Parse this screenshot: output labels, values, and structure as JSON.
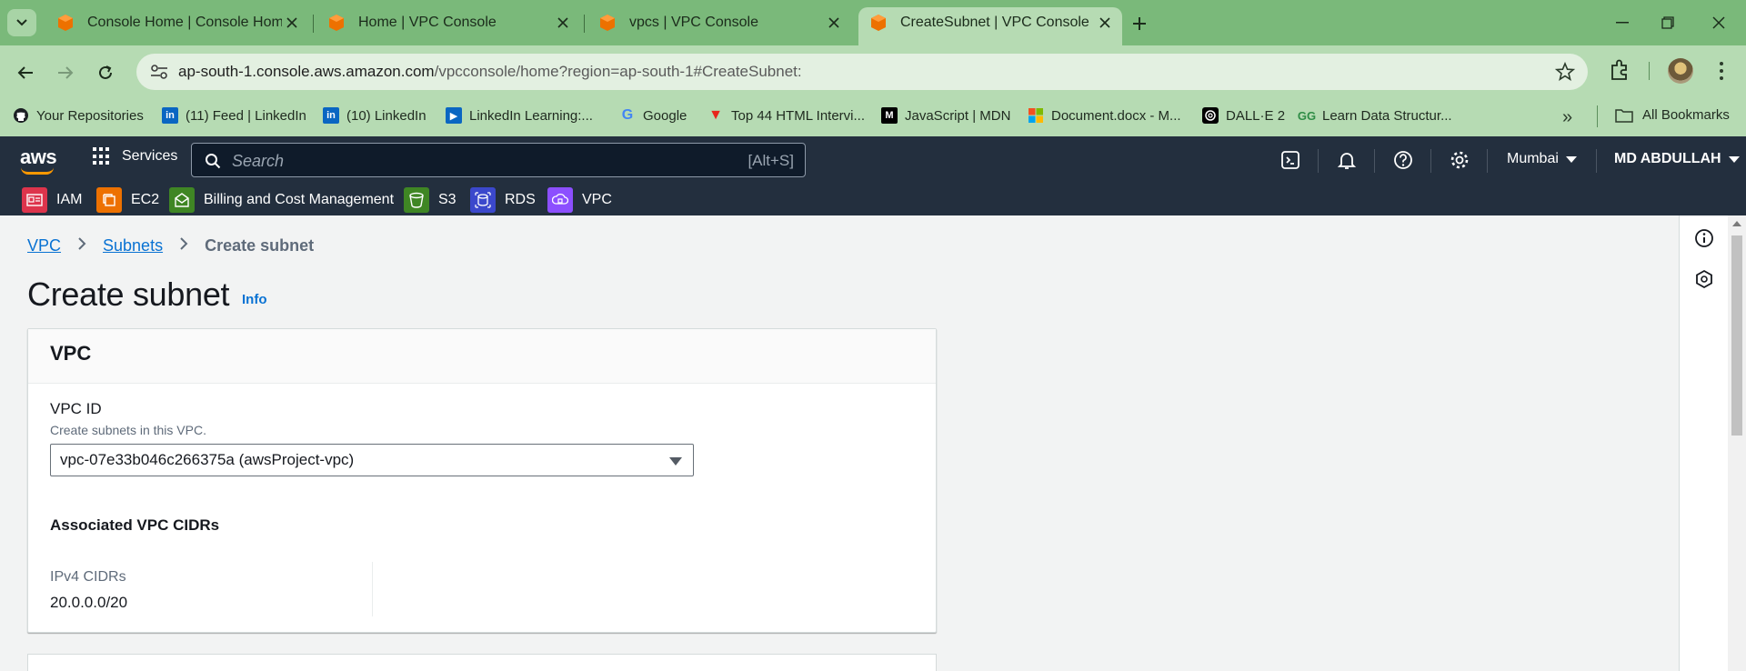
{
  "browser": {
    "tabs": [
      {
        "title": "Console Home | Console Home",
        "active": false
      },
      {
        "title": "Home | VPC Console",
        "active": false
      },
      {
        "title": "vpcs | VPC Console",
        "active": false
      },
      {
        "title": "CreateSubnet | VPC Console",
        "active": true
      }
    ],
    "url_host": "ap-south-1.console.aws.amazon.com",
    "url_path": "/vpcconsole/home?region=ap-south-1#CreateSubnet:",
    "bookmarks": [
      {
        "label": "Your Repositories",
        "icon": "github-icon"
      },
      {
        "label": "(11) Feed | LinkedIn",
        "icon": "linkedin-icon"
      },
      {
        "label": "(10) LinkedIn",
        "icon": "linkedin-icon"
      },
      {
        "label": "LinkedIn Learning:...",
        "icon": "linkedin-learning-icon"
      },
      {
        "label": "Google",
        "icon": "google-icon"
      },
      {
        "label": "Top 44 HTML Intervi...",
        "icon": "v-icon"
      },
      {
        "label": "JavaScript | MDN",
        "icon": "mdn-icon"
      },
      {
        "label": "Document.docx - M...",
        "icon": "microsoft-icon"
      },
      {
        "label": "DALL·E 2",
        "icon": "openai-icon"
      },
      {
        "label": "Learn Data Structur...",
        "icon": "gfg-icon"
      }
    ],
    "all_bookmarks": "All Bookmarks"
  },
  "aws": {
    "services_label": "Services",
    "search_placeholder": "Search",
    "search_shortcut": "[Alt+S]",
    "region": "Mumbai",
    "user": "MD ABDULLAH",
    "favorites": [
      {
        "label": "IAM",
        "color": "#dd344c"
      },
      {
        "label": "EC2",
        "color": "#ed7100"
      },
      {
        "label": "Billing and Cost Management",
        "color": "#3f8624"
      },
      {
        "label": "S3",
        "color": "#3f8624"
      },
      {
        "label": "RDS",
        "color": "#3b48cc"
      },
      {
        "label": "VPC",
        "color": "#8c4fff"
      }
    ]
  },
  "page": {
    "breadcrumb": [
      "VPC",
      "Subnets",
      "Create subnet"
    ],
    "title": "Create subnet",
    "info_label": "Info",
    "vpc_section": {
      "heading": "VPC",
      "field_label": "VPC ID",
      "field_description": "Create subnets in this VPC.",
      "selected_vpc": "vpc-07e33b046c266375a (awsProject-vpc)",
      "associated_heading": "Associated VPC CIDRs",
      "ipv4_label": "IPv4 CIDRs",
      "ipv4_value": "20.0.0.0/20"
    }
  },
  "colors": {
    "tabstrip": "#7ab97a",
    "toolbar": "#b6dbb3",
    "aws_nav": "#232f3e",
    "link": "#0972d3"
  }
}
